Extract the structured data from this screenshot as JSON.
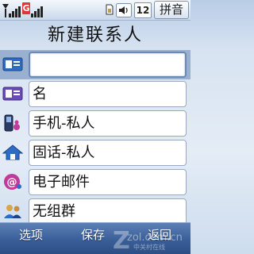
{
  "status_bar": {
    "network_badge": "G",
    "volume_level": "12",
    "input_mode": "拼音"
  },
  "title": "新建联系人",
  "fields": [
    {
      "icon": "contact-card-icon",
      "value": ""
    },
    {
      "icon": "name-card-icon",
      "value": "名"
    },
    {
      "icon": "mobile-phone-icon",
      "value": "手机-私人"
    },
    {
      "icon": "home-icon",
      "value": "固话-私人"
    },
    {
      "icon": "email-at-icon",
      "value": "电子邮件"
    },
    {
      "icon": "group-icon",
      "value": "无组群"
    }
  ],
  "softkeys": {
    "left": "选项",
    "center": "保存",
    "right": "返回"
  },
  "watermark": {
    "text": "zol.com.cn",
    "subtext": "中关村在线"
  },
  "colors": {
    "accent": "#3a5e98",
    "selection": "#9ab0d0",
    "network_badge": "#e23636"
  }
}
